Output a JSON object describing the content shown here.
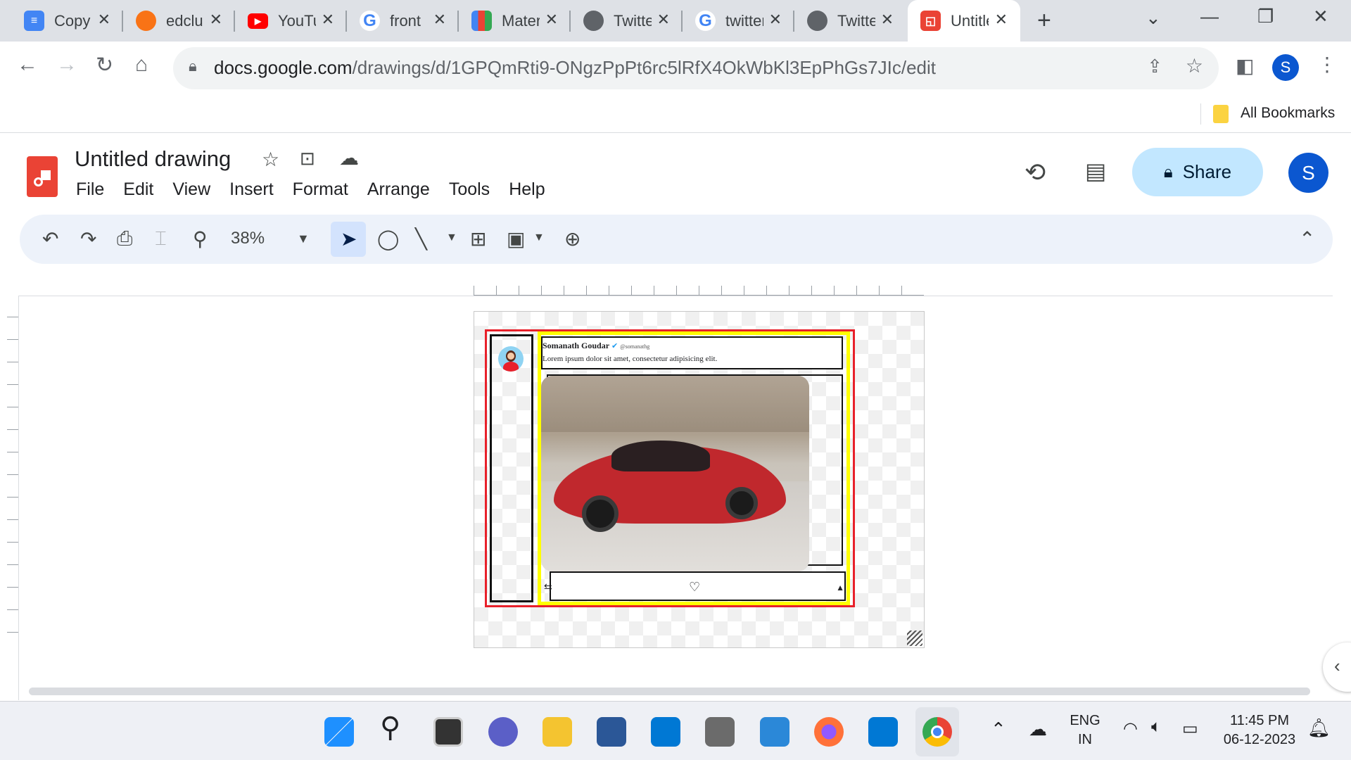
{
  "browser": {
    "tabs": [
      {
        "title": "Copy",
        "favicon": "docs-icon",
        "color": "#4285f4"
      },
      {
        "title": "edclub",
        "favicon": "edclub-icon",
        "color": "#f97316"
      },
      {
        "title": "YouTube",
        "favicon": "youtube-icon",
        "color": "#ff0000"
      },
      {
        "title": "front",
        "favicon": "google-icon",
        "color": "#4285f4"
      },
      {
        "title": "Material",
        "favicon": "material-icon",
        "color": "#34a853"
      },
      {
        "title": "Twitter",
        "favicon": "globe-icon",
        "color": "#5f6368"
      },
      {
        "title": "twitter",
        "favicon": "google-icon",
        "color": "#4285f4"
      },
      {
        "title": "Twitter",
        "favicon": "globe-icon",
        "color": "#5f6368"
      },
      {
        "title": "Untitled",
        "favicon": "drawings-icon",
        "color": "#ea4335",
        "active": true
      }
    ],
    "url_host": "docs.google.com",
    "url_path": "/drawings/d/1GPQmRti9-ONgzPpPt6rc5lRfX4OkWbKl3EpPhGs7JIc/edit",
    "profile_initial": "S",
    "bookmarks_label": "All Bookmarks"
  },
  "app": {
    "doc_title": "Untitled drawing",
    "menu": [
      "File",
      "Edit",
      "View",
      "Insert",
      "Format",
      "Arrange",
      "Tools",
      "Help"
    ],
    "share_label": "Share",
    "user_initial": "S",
    "zoom": "38%"
  },
  "drawing": {
    "author_name": "Somanath Goudar",
    "author_handle": "@somanathg",
    "body_text": "Lorem ipsum dolor sit amet, consectetur adipisicing elit."
  },
  "system": {
    "lang_line1": "ENG",
    "lang_line2": "IN",
    "time": "11:45 PM",
    "date": "06-12-2023"
  },
  "colors": {
    "accent": "#0b57d0",
    "share_bg": "#c2e7ff",
    "outline_red": "#e8202a",
    "outline_yellow": "#ffff00",
    "car_red": "#c0282d"
  }
}
